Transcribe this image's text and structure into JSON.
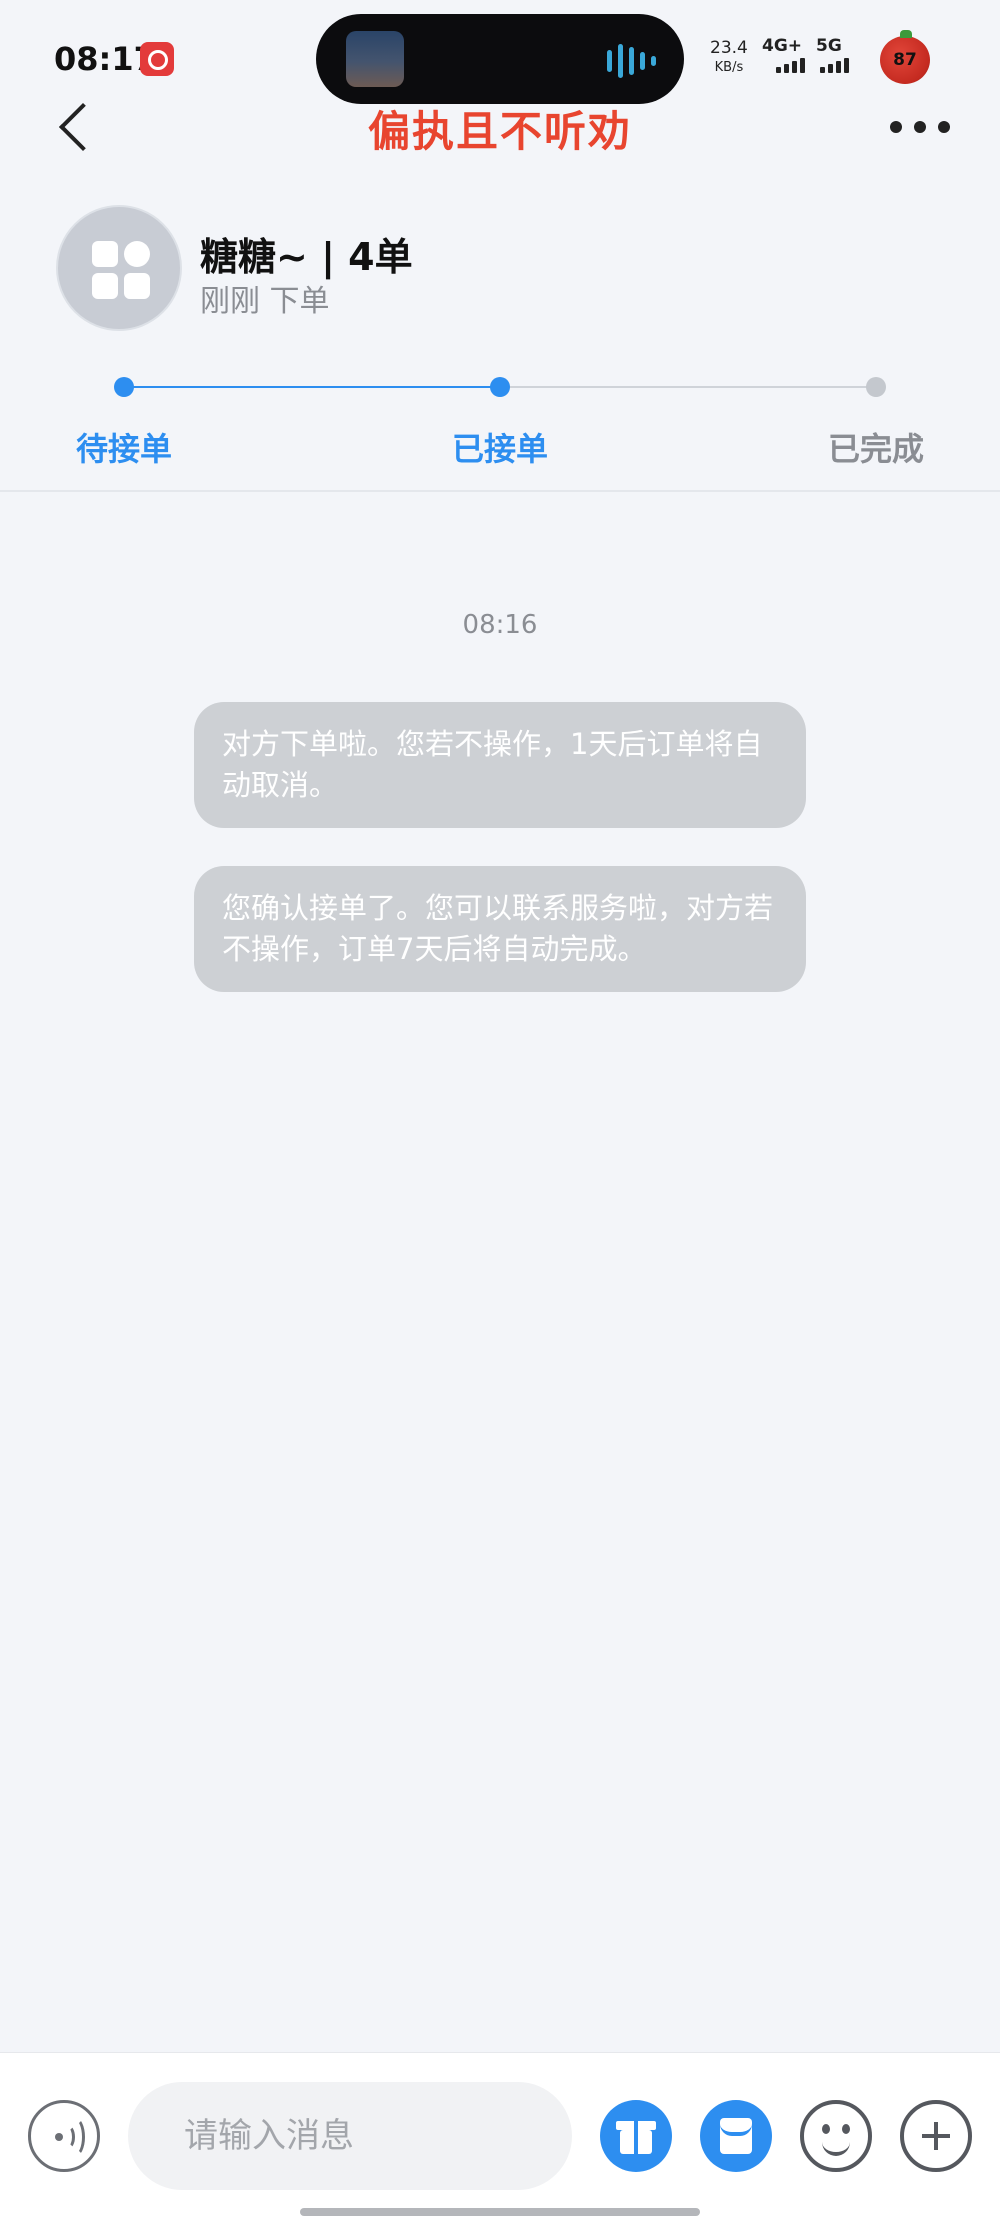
{
  "status_bar": {
    "time": "08:17",
    "net_speed_value": "23.4",
    "net_speed_unit": "KB/s",
    "signal_1": "4G+",
    "signal_2": "5G",
    "battery": "87"
  },
  "nav": {
    "title": "偏执且不听劝"
  },
  "customer": {
    "name": "糖糖~ | 4单",
    "order_time": "刚刚 下单"
  },
  "progress": {
    "steps": [
      {
        "label": "待接单",
        "state": "done"
      },
      {
        "label": "已接单",
        "state": "current"
      },
      {
        "label": "已完成",
        "state": "pending"
      }
    ],
    "colors": {
      "active": "#2d8ef0",
      "inactive": "#8a8d93",
      "pending_dot": "#c4c8ce"
    }
  },
  "chat": {
    "timestamp": "08:16",
    "messages": [
      {
        "text": "对方下单啦。您若不操作，1天后订单将自动取消。"
      },
      {
        "text": "您确认接单了。您可以联系服务啦，对方若不操作，订单7天后将自动完成。"
      }
    ]
  },
  "input_bar": {
    "placeholder": "请输入消息",
    "icons": [
      "voice-icon",
      "gift-icon",
      "red-packet-icon",
      "emoji-icon",
      "plus-icon"
    ]
  }
}
